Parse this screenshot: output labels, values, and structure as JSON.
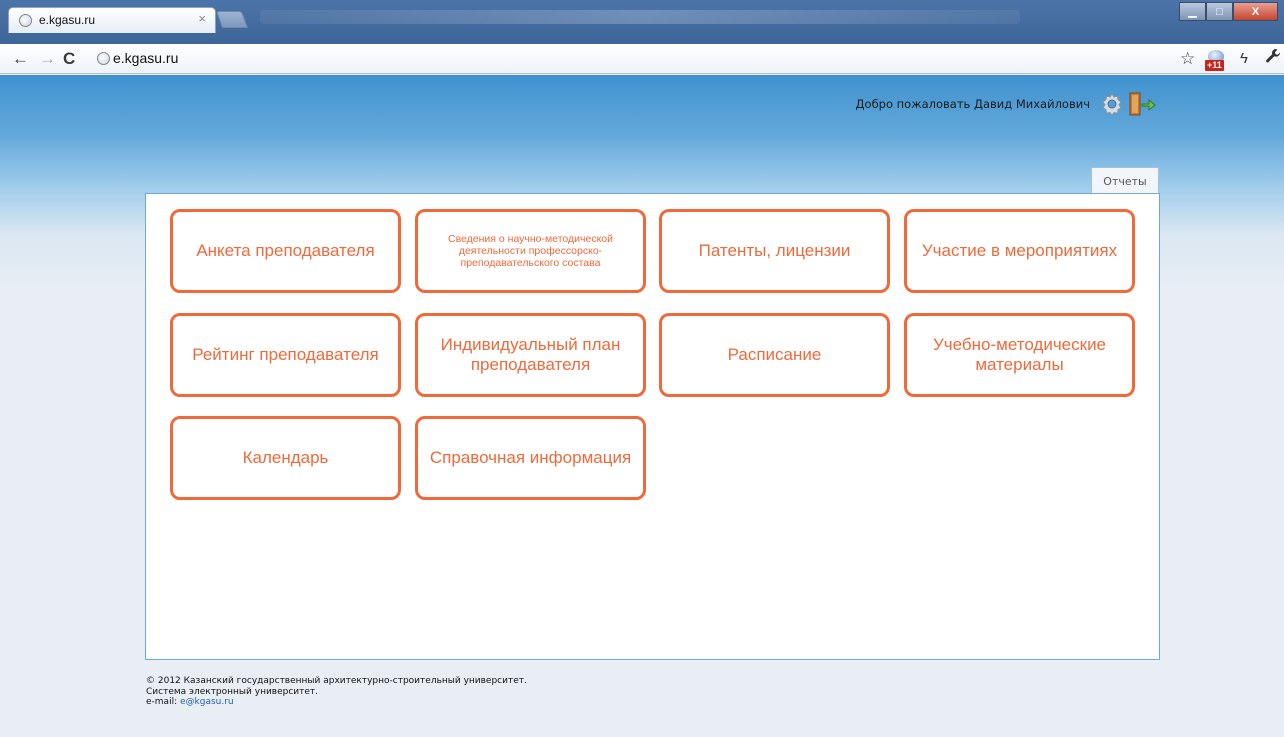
{
  "browser": {
    "tab_title": "e.kgasu.ru",
    "tab_close": "×",
    "url": "e.kgasu.ru",
    "ext_badge": "+11",
    "window_buttons": {
      "minimize": "▁",
      "maximize": "□",
      "close": "X"
    },
    "icons": {
      "back": "←",
      "forward": "→",
      "reload": "C",
      "star": "☆",
      "flash": "ϟ",
      "wrench": "🔧"
    }
  },
  "header": {
    "welcome": "Добро пожаловать Давид Михайлович"
  },
  "tabs": [
    {
      "label": "Отчеты"
    }
  ],
  "tiles": [
    {
      "label": "Анкета преподавателя"
    },
    {
      "label": "Сведения о научно-методической деятельности профессорско-преподавательского состава"
    },
    {
      "label": "Патенты, лицензии"
    },
    {
      "label": "Участие в мероприятиях"
    },
    {
      "label": "Рейтинг преподавателя"
    },
    {
      "label": "Индивидуальный план преподавателя"
    },
    {
      "label": "Расписание"
    },
    {
      "label": "Учебно-методические материалы"
    },
    {
      "label": "Календарь"
    },
    {
      "label": "Справочная информация"
    }
  ],
  "footer": {
    "copyright": "© 2012 Казанский государственный архитектурно-строительный университет.",
    "system": "Система электронный университет.",
    "email_label": "e-mail:",
    "email": "e@kgasu.ru"
  },
  "colors": {
    "accent": "#f0693a",
    "panel_border": "#6fa9d6",
    "header_blue": "#3f92cf"
  }
}
